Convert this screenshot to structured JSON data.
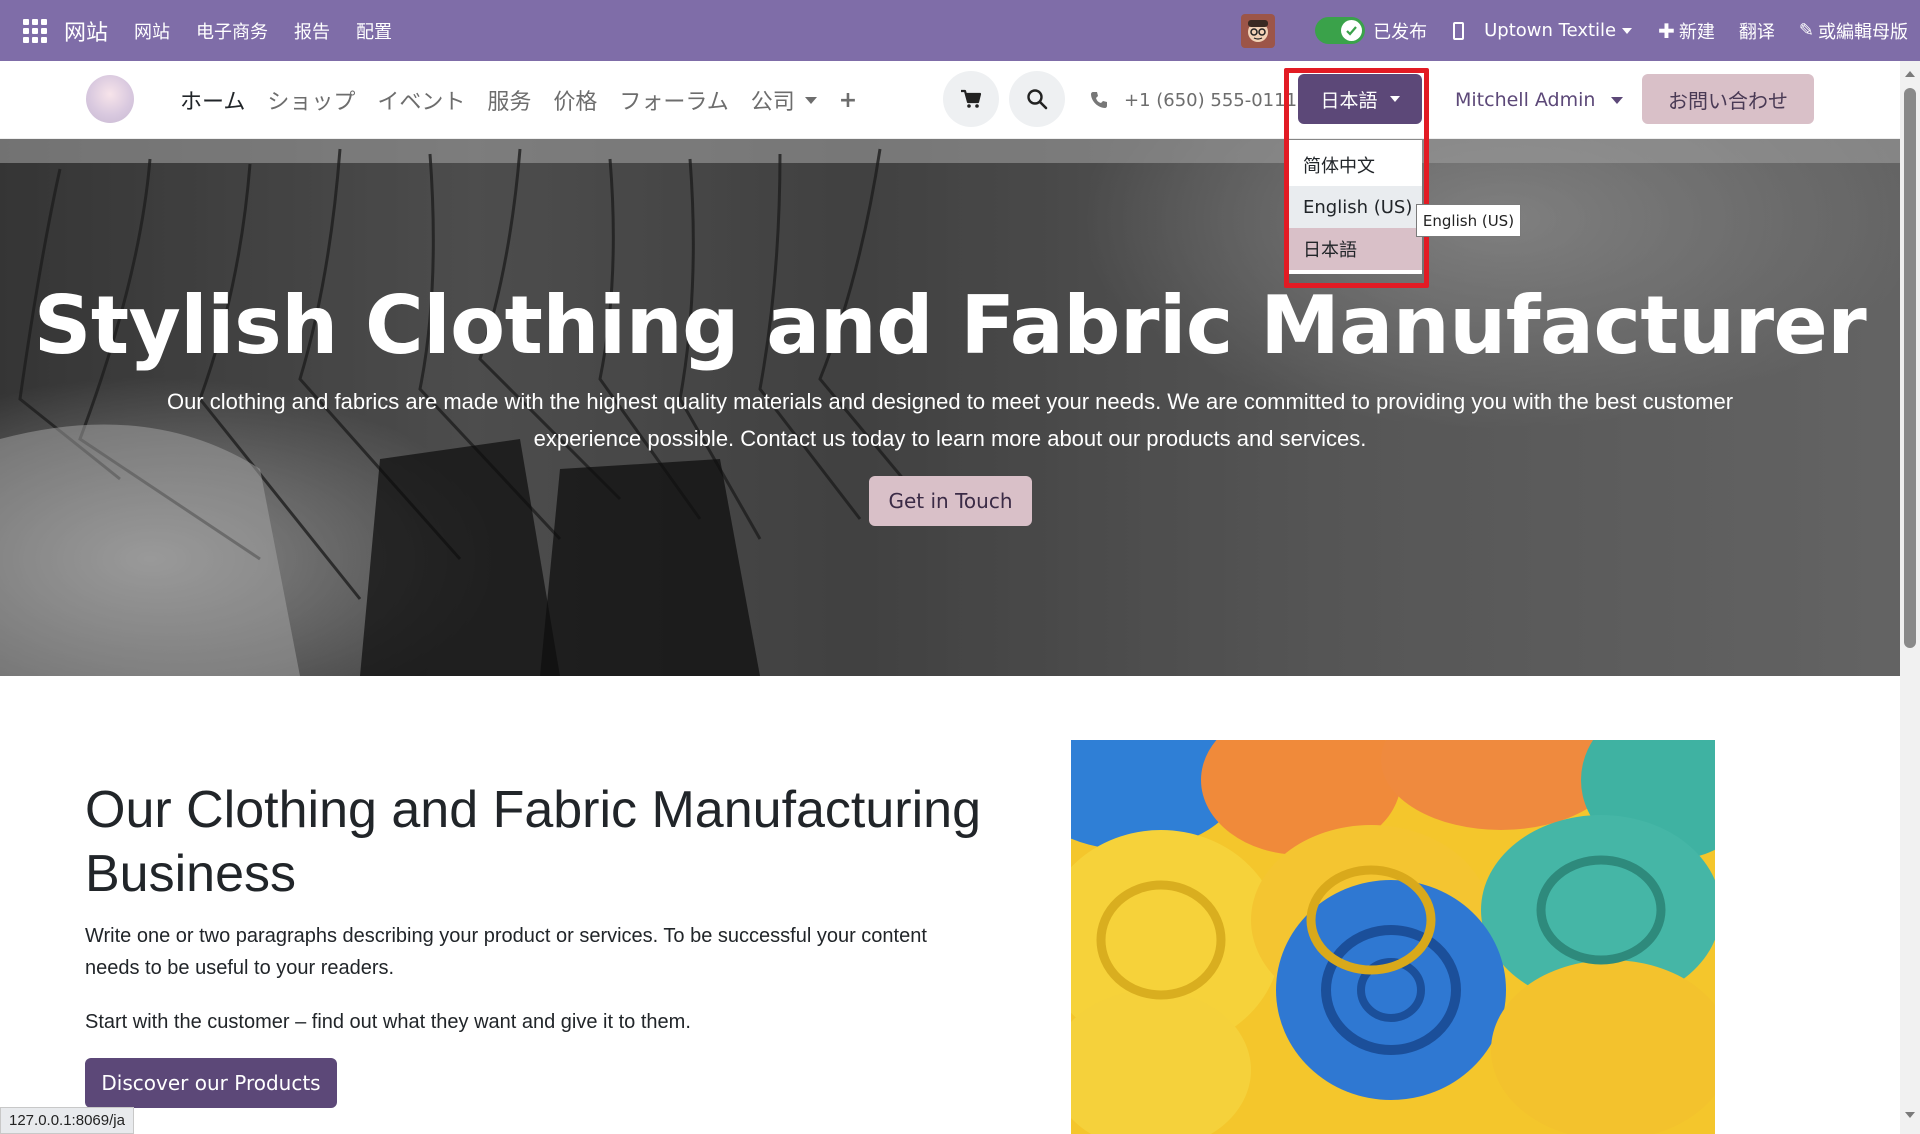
{
  "admin_bar": {
    "brand": "网站",
    "menu": [
      "网站",
      "电子商务",
      "报告",
      "配置"
    ],
    "published_label": "已发布",
    "website_selector": "Uptown Textile",
    "new_label": "新建",
    "translate_label": "翻译",
    "edit_label": "或編輯母版"
  },
  "site_nav": {
    "menu": [
      "ホーム",
      "ショップ",
      "イベント",
      "服务",
      "价格",
      "フォーラム",
      "公司"
    ],
    "phone": "+1 (650) 555-0111",
    "language_button": "日本語",
    "user": "Mitchell Admin",
    "contact_button": "お問い合わせ"
  },
  "language_dropdown": {
    "items": [
      "简体中文",
      "English (US)",
      "日本語"
    ],
    "tooltip": "English (US)"
  },
  "hero": {
    "title": "Stylish Clothing and Fabric Manufacturer",
    "subtitle": "Our clothing and fabrics are made with the highest quality materials and designed to meet your needs. We are committed to providing you with the best customer experience possible. Contact us today to learn more about our products and services.",
    "button": "Get in Touch"
  },
  "content": {
    "heading": "Our Clothing and Fabric Manufacturing Business",
    "paragraph1": "Write one or two paragraphs describing your product or services. To be successful your content needs to be useful to your readers.",
    "paragraph2": "Start with the customer – find out what they want and give it to them.",
    "button": "Discover our Products"
  },
  "status_url": "127.0.0.1:8069/ja",
  "colors": {
    "admin_bar": "#7f6da8",
    "primary": "#5c4878",
    "secondary": "#d9c0c8",
    "highlight_border": "#e21b24"
  }
}
